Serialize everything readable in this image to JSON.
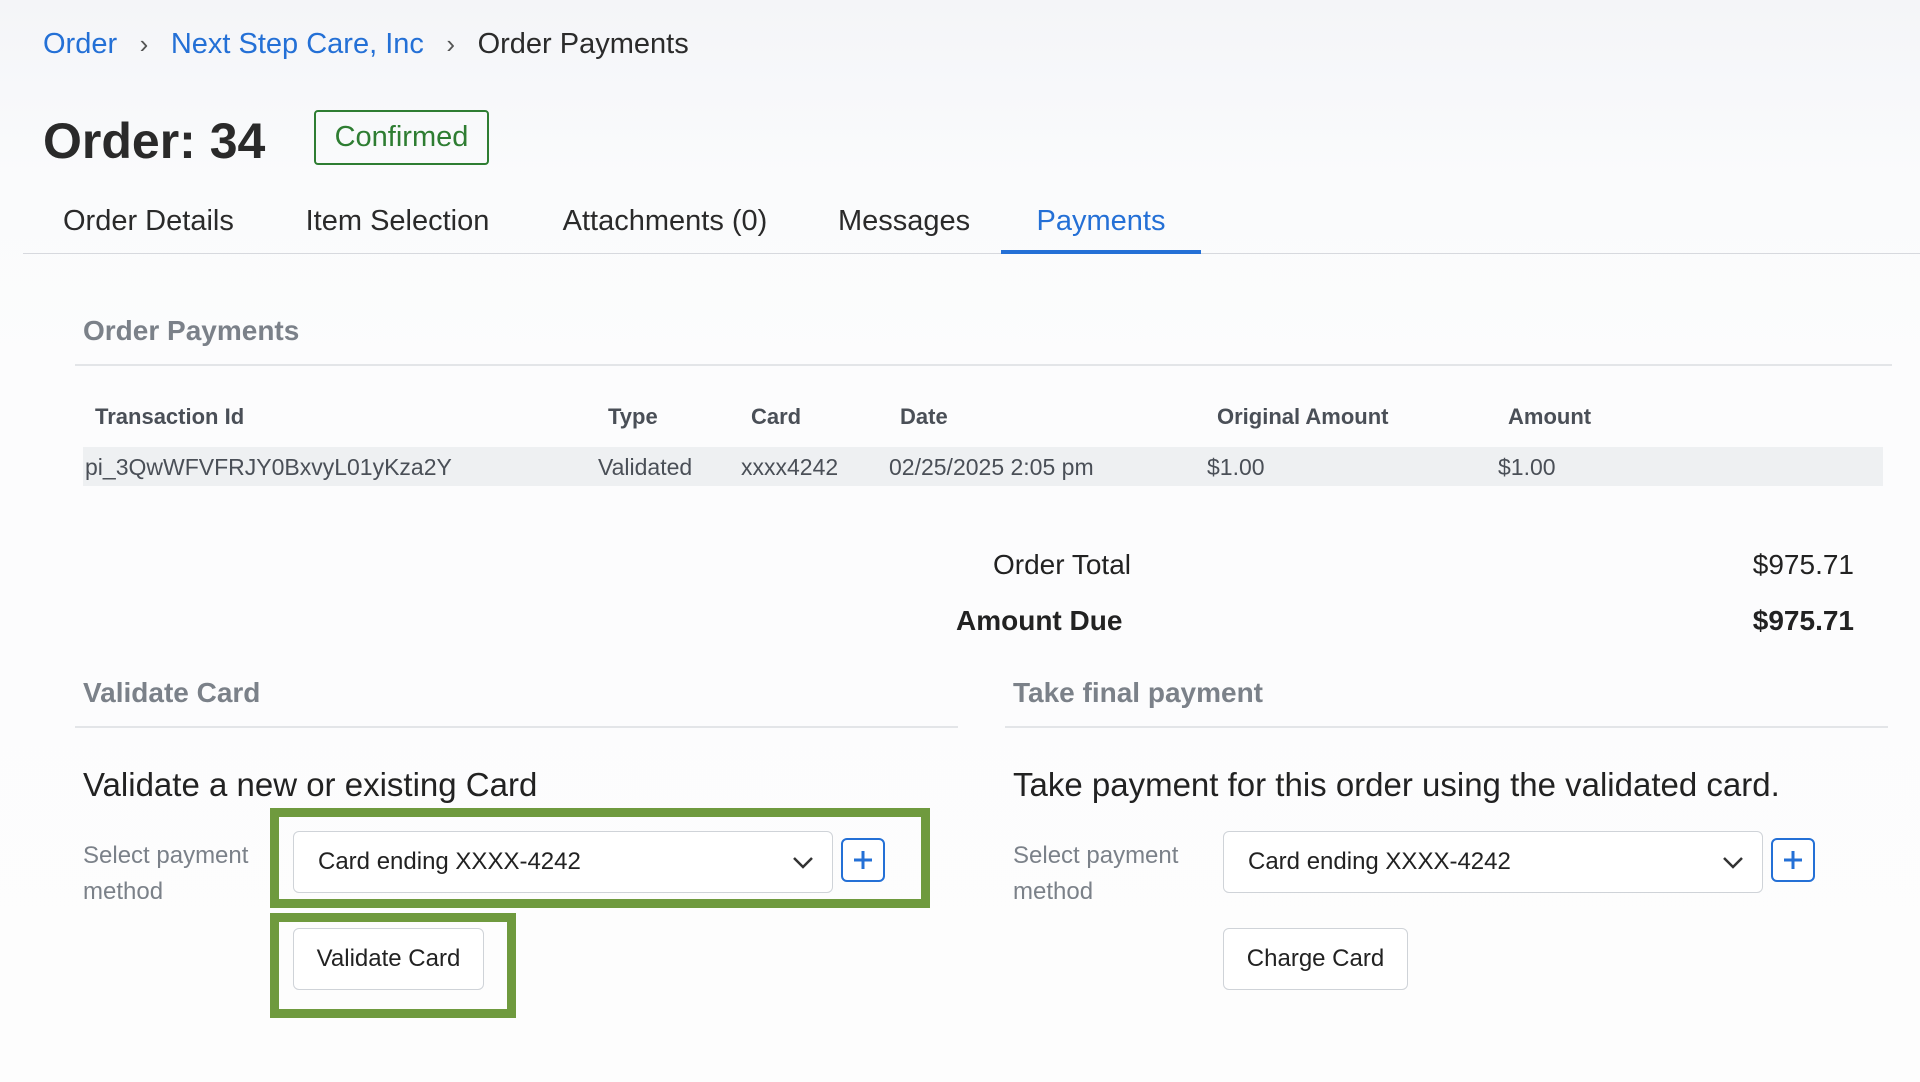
{
  "breadcrumb": {
    "items": [
      "Order",
      "Next Step Care, Inc"
    ],
    "current": "Order Payments",
    "separator": ">"
  },
  "header": {
    "title": "Order: 34",
    "status": "Confirmed",
    "status_color": "#2e7d32"
  },
  "tabs": [
    "Order Details",
    "Item Selection",
    "Attachments (0)",
    "Messages",
    "Payments"
  ],
  "active_tab": "Payments",
  "order_payments": {
    "heading": "Order Payments",
    "columns": [
      "Transaction Id",
      "Type",
      "Card",
      "Date",
      "Original Amount",
      "Amount"
    ],
    "rows": [
      {
        "transaction_id": "pi_3QwWFVFRJY0BxvyL01yKza2Y",
        "type": "Validated",
        "card": "xxxx4242",
        "date": "02/25/2025 2:05 pm",
        "original_amount": "$1.00",
        "amount": "$1.00"
      }
    ]
  },
  "totals": {
    "order_total_label": "Order Total",
    "order_total_value": "$975.71",
    "amount_due_label": "Amount Due",
    "amount_due_value": "$975.71"
  },
  "validate_card": {
    "heading": "Validate Card",
    "subheading": "Validate a new or existing Card",
    "payment_label": "Select payment method",
    "selected": "Card ending XXXX-4242",
    "add_icon": "plus-icon",
    "button": "Validate Card"
  },
  "final_payment": {
    "heading": "Take final payment",
    "subheading": "Take payment for this order using the validated card.",
    "payment_label": "Select payment method",
    "selected": "Card ending XXXX-4242",
    "add_icon": "plus-icon",
    "button": "Charge Card"
  },
  "colors": {
    "accent": "#2470d6",
    "highlight": "#6f9a3e",
    "heading_gray": "#7b8189"
  }
}
